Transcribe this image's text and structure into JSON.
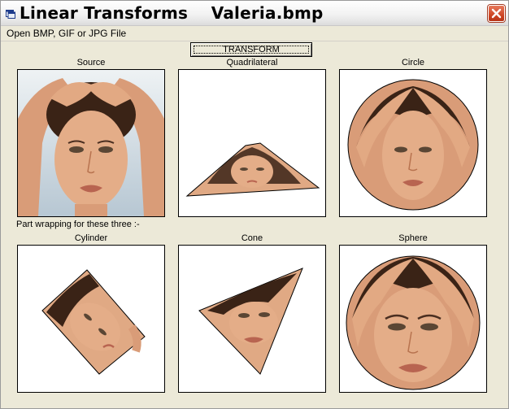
{
  "window": {
    "title": "Linear Transforms    Valeria.bmp",
    "icons": {
      "app": "app-window-icon",
      "close": "close-icon"
    }
  },
  "menu": {
    "open_label": "Open BMP, GIF or JPG File"
  },
  "toolbar": {
    "transform_label": "TRANSFORM"
  },
  "panels": {
    "source": {
      "caption": "Source"
    },
    "quadrilateral": {
      "caption": "Quadrilateral"
    },
    "circle": {
      "caption": "Circle"
    },
    "cylinder": {
      "caption": "Cylinder"
    },
    "cone": {
      "caption": "Cone"
    },
    "sphere": {
      "caption": "Sphere"
    }
  },
  "note": "Part wrapping for these three :-",
  "colors": {
    "skin": "#e0a984",
    "skin_dark": "#b8734f",
    "hair": "#3a2316",
    "backdrop": "#c9d6de",
    "close": "#c9401f"
  }
}
